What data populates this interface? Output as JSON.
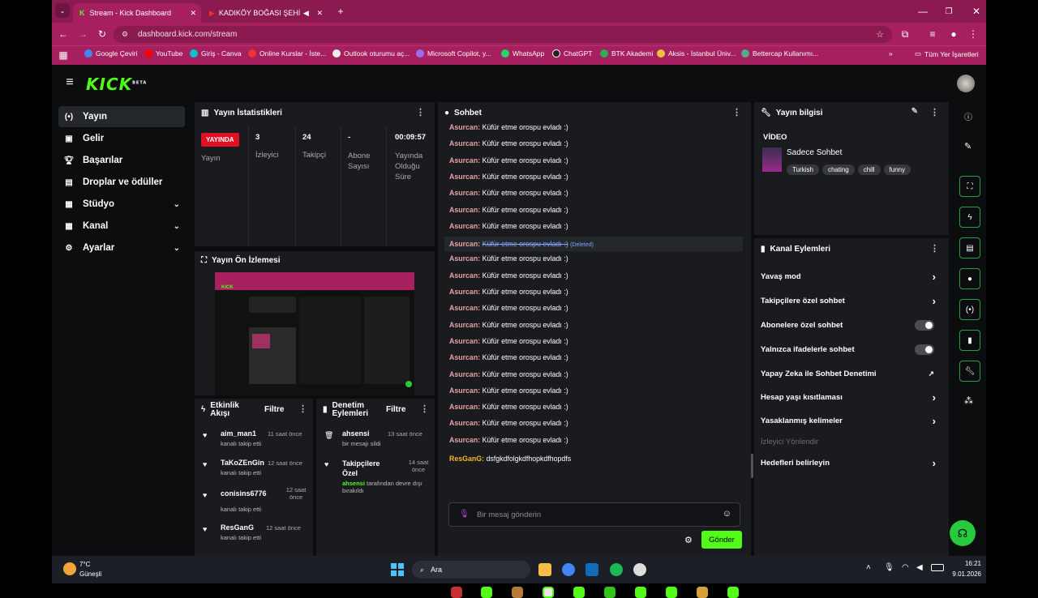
{
  "browser": {
    "tabs": [
      {
        "label": "Stream - Kick Dashboard"
      },
      {
        "label": "KADIKÖY BOĞASI ŞEHİNŞAH"
      }
    ],
    "url": "dashboard.kick.com/stream",
    "bookmarks": [
      "Google Çeviri",
      "YouTube",
      "Giriş - Canva",
      "Online Kurslar - İste...",
      "Outlook oturumu aç...",
      "Microsoft Copilot, y...",
      "WhatsApp",
      "ChatGPT",
      "BTK Akademi",
      "Aksis - İstanbul Üniv...",
      "Bettercap Kullanımı..."
    ],
    "all_bookmarks": "Tüm Yer İşaretleri"
  },
  "app": {
    "logo": "KICK",
    "logo_badge": "BETA",
    "sidebar": [
      {
        "label": "Yayın",
        "icon": "broadcast-icon"
      },
      {
        "label": "Gelir",
        "icon": "wallet-icon"
      },
      {
        "label": "Başarılar",
        "icon": "trophy-icon"
      },
      {
        "label": "Droplar ve ödüller",
        "icon": "gift-icon"
      },
      {
        "label": "Stüdyo",
        "icon": "studio-icon"
      },
      {
        "label": "Kanal",
        "icon": "channel-icon"
      },
      {
        "label": "Ayarlar",
        "icon": "gear-icon"
      }
    ]
  },
  "stats": {
    "title": "Yayın İstatistikleri",
    "live_badge": "YAYINDA",
    "live_label": "Yayın",
    "viewers_value": "3",
    "viewers_label": "İzleyici",
    "followers_value": "24",
    "followers_label": "Takipçi",
    "subs_value": "-",
    "subs_label": "Abone Sayısı",
    "uptime_value": "00:09:57",
    "uptime_label": "Yayında Olduğu Süre"
  },
  "preview": {
    "title": "Yayın Ön İzlemesi"
  },
  "activity": {
    "title": "Etkinlik Akışı",
    "filter": "Filtre",
    "items": [
      {
        "user": "aim_man1",
        "time": "11 saat önce",
        "text": "kanalı takip etti"
      },
      {
        "user": "TaKoZEnGin",
        "time": "12 saat önce",
        "text": "kanalı takip etti"
      },
      {
        "user": "conisins6776",
        "time": "12 saat önce",
        "text": "kanalı takip etti"
      },
      {
        "user": "ResGanG",
        "time": "12 saat önce",
        "text": "kanalı takip etti"
      }
    ]
  },
  "moderation": {
    "title": "Denetim Eylemleri",
    "filter": "Filtre",
    "items": [
      {
        "user": "ahsensi",
        "time": "13 saat önce",
        "text": "bir mesajı sildi"
      },
      {
        "user": "Takipçilere Özel",
        "time": "14 saat önce",
        "actor": "ahsensi",
        "text": "tarafından devre dışı bırakıldı"
      }
    ]
  },
  "chat": {
    "title": "Sohbet",
    "user": "Asurcan:",
    "message": "Küfür etme orospu evladı :)",
    "deleted_tag": "(Deleted)",
    "last_user": "ResGanG:",
    "last_message": "dsfgkdfolgkdfhopkdfhopdfs",
    "placeholder": "Bir mesaj gönderin",
    "send": "Gönder"
  },
  "stream_info": {
    "title": "Yayın bilgisi",
    "category": "VİDEO",
    "stream_title": "Sadece Sohbet",
    "tags": [
      "Turkish",
      "chating",
      "chill",
      "funny"
    ]
  },
  "channel_actions": {
    "title": "Kanal Eylemleri",
    "items": [
      {
        "label": "Yavaş mod",
        "control": "chevron"
      },
      {
        "label": "Takipçilere özel sohbet",
        "control": "chevron"
      },
      {
        "label": "Abonelere özel sohbet",
        "control": "toggle"
      },
      {
        "label": "Yalnızca ifadelerle sohbet",
        "control": "toggle"
      },
      {
        "label": "Yapay Zeka ile Sohbet Denetimi",
        "control": "external"
      },
      {
        "label": "Hesap yaşı kısıtlaması",
        "control": "chevron"
      },
      {
        "label": "Yasaklanmış kelimeler",
        "control": "chevron"
      },
      {
        "label": "İzleyici Yönlendir",
        "control": "disabled"
      },
      {
        "label": "Hedefleri belirleyin",
        "control": "chevron"
      }
    ]
  },
  "taskbar": {
    "weather_temp": "7°C",
    "weather_text": "Güneşli",
    "search": "Ara",
    "time": "16:21",
    "date": "9.01.2026"
  },
  "colors": {
    "brand": "#53fc18",
    "chrome": "#a61f5e",
    "live": "#e00f26"
  }
}
